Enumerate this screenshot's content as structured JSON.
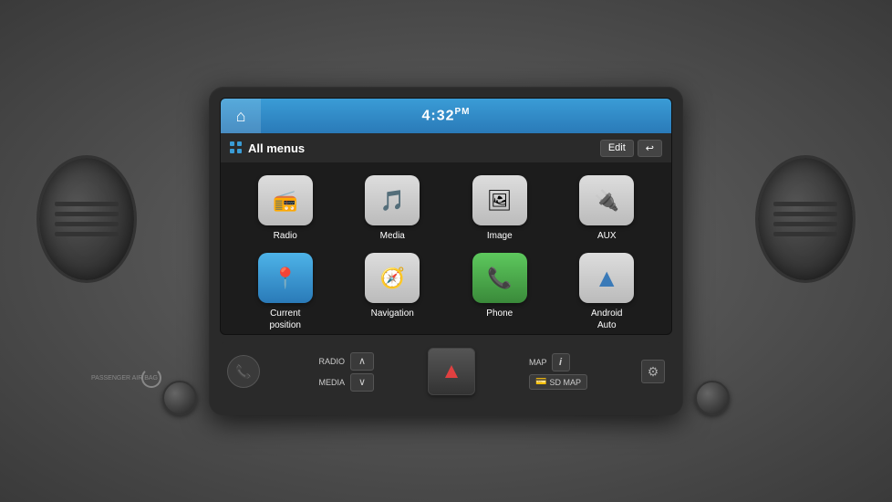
{
  "dashboard": {
    "bg_color": "#6b6b6b"
  },
  "screen": {
    "header": {
      "time": "4:32",
      "time_suffix": "PM",
      "home_icon": "⌂"
    },
    "subheader": {
      "title": "All menus",
      "edit_label": "Edit",
      "back_label": "↩"
    },
    "apps": [
      {
        "id": "radio",
        "label": "Radio",
        "icon": "📻",
        "bg": "default"
      },
      {
        "id": "media",
        "label": "Media",
        "icon": "🎵",
        "bg": "default"
      },
      {
        "id": "image",
        "label": "Image",
        "icon": "🖼",
        "bg": "default"
      },
      {
        "id": "aux",
        "label": "AUX",
        "icon": "🔌",
        "bg": "default"
      },
      {
        "id": "current-position",
        "label": "Current\nposition",
        "icon": "📍",
        "bg": "blue-bg"
      },
      {
        "id": "navigation",
        "label": "Navigation",
        "icon": "🧭",
        "bg": "default"
      },
      {
        "id": "phone",
        "label": "Phone",
        "icon": "📞",
        "bg": "green-bg"
      },
      {
        "id": "android-auto",
        "label": "Android\nAuto",
        "icon": "▲",
        "bg": "default"
      }
    ]
  },
  "controls": {
    "radio_label": "RADIO",
    "media_label": "MEDIA",
    "map_label": "MAP",
    "sd_map_label": "SD MAP",
    "up_arrow": "∧",
    "down_arrow": "∨",
    "hazard_symbol": "▲",
    "info_symbol": "i",
    "gear_symbol": "⚙",
    "phone_symbol": "📞",
    "airbag_label": "PASSENGER\nAIR BAG"
  }
}
